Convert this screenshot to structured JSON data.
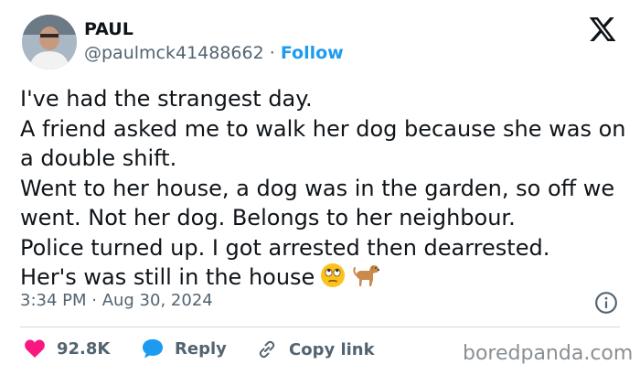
{
  "user": {
    "name": "PAUL",
    "handle": "@paulmck41488662",
    "separator": "·",
    "follow_label": "Follow"
  },
  "tweet": {
    "text": "I've had the strangest day.\nA friend asked me to walk her dog because she was on a double shift.\nWent to her house, a dog was in the garden, so off we went. Not her dog. Belongs to her neighbour.\nPolice turned up. I got arrested then dearrested.\nHer's was still in the house",
    "emojis": [
      "face-with-rolling-eyes",
      "dog"
    ],
    "timestamp": "3:34 PM · Aug 30, 2024"
  },
  "actions": {
    "like_count": "92.8K",
    "reply_label": "Reply",
    "copy_label": "Copy link"
  },
  "watermark": "boredpanda.com",
  "colors": {
    "text": "#0f1419",
    "secondary": "#536471",
    "accent": "#1d9bf0",
    "like": "#f91880"
  }
}
